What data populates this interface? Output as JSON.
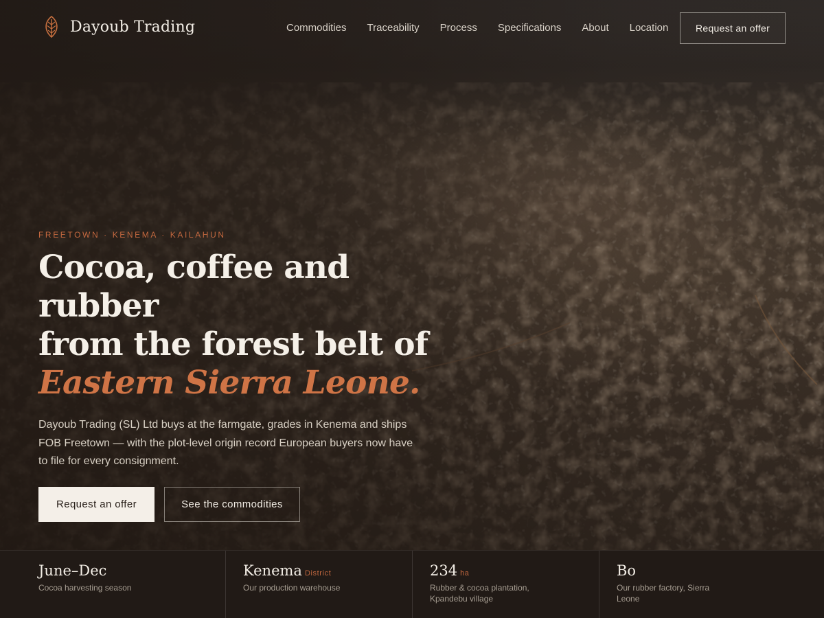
{
  "header": {
    "brand_name": "Dayoub Trading",
    "logo_icon": "leaf-icon",
    "nav": [
      {
        "label": "Commodities"
      },
      {
        "label": "Traceability"
      },
      {
        "label": "Process"
      },
      {
        "label": "Specifications"
      },
      {
        "label": "About"
      },
      {
        "label": "Location"
      }
    ],
    "cta_label": "Request an offer"
  },
  "hero": {
    "eyebrow": "FREETOWN · KENEMA · KAILAHUN",
    "headline_line1": "Cocoa, coffee and",
    "headline_line2": "rubber",
    "headline_line3": "from the forest belt of",
    "headline_accent": "Eastern Sierra Leone.",
    "lede": "Dayoub Trading (SL) Ltd buys at the farmgate, grades in Kenema and ships FOB Freetown — with the plot-level origin record European buyers now have to file for every consignment.",
    "primary_button": "Request an offer",
    "secondary_button": "See the commodities"
  },
  "stats": [
    {
      "value": "June–Dec",
      "unit": "",
      "label": "Cocoa harvesting season"
    },
    {
      "value": "Kenema",
      "unit": "District",
      "label": "Our production warehouse"
    },
    {
      "value": "234",
      "unit": "ha",
      "label": "Rubber & cocoa plantation, Kpandebu village"
    },
    {
      "value": "Bo",
      "unit": "",
      "label": "Our rubber factory, Sierra Leone"
    }
  ],
  "colors": {
    "accent": "#cf7446",
    "background": "#211a16",
    "text": "#f3eee6"
  }
}
